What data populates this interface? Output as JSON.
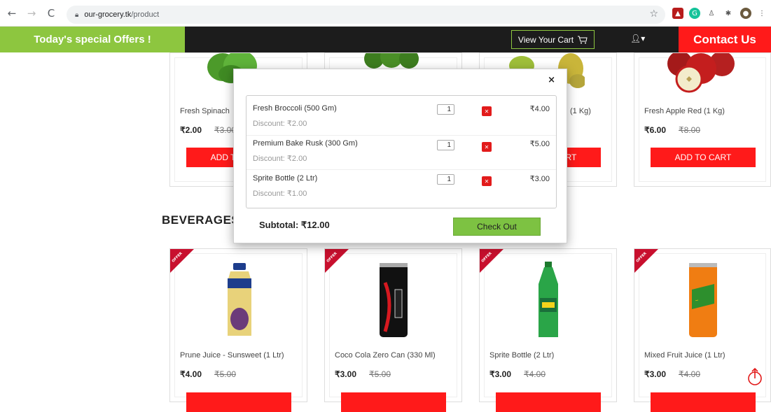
{
  "browser": {
    "url_host": "our-grocery.tk",
    "url_path": "/product"
  },
  "navbar": {
    "offers": "Today's special Offers !",
    "view_cart": "View Your Cart",
    "contact": "Contact Us"
  },
  "top_products": [
    {
      "name": "Fresh Spinach",
      "price": "₹2.00",
      "old_price": "₹3.00",
      "button": "ADD TO CART"
    },
    {
      "name": "",
      "price": "",
      "old_price": "",
      "button": ""
    },
    {
      "name": "(1 Kg)",
      "price": "",
      "old_price": "",
      "button": "ADD TO CART"
    },
    {
      "name": "Fresh Apple Red (1 Kg)",
      "price": "₹6.00",
      "old_price": "₹8.00",
      "button": "ADD TO CART"
    }
  ],
  "section_title": "BEVERAGES",
  "beverages": [
    {
      "name": "Prune Juice - Sunsweet (1 Ltr)",
      "price": "₹4.00",
      "old_price": "₹5.00",
      "ribbon": "OFFER"
    },
    {
      "name": "Coco Cola Zero Can (330 Ml)",
      "price": "₹3.00",
      "old_price": "₹5.00",
      "ribbon": "OFFER"
    },
    {
      "name": "Sprite Bottle (2 Ltr)",
      "price": "₹3.00",
      "old_price": "₹4.00",
      "ribbon": "OFFER"
    },
    {
      "name": "Mixed Fruit Juice (1 Ltr)",
      "price": "₹3.00",
      "old_price": "₹4.00",
      "ribbon": "OFFER"
    }
  ],
  "cart": {
    "close": "×",
    "items": [
      {
        "name": "Fresh Broccoli (500 Gm)",
        "discount": "Discount: ₹2.00",
        "qty": "1",
        "price": "₹4.00"
      },
      {
        "name": "Premium Bake Rusk (300 Gm)",
        "discount": "Discount: ₹2.00",
        "qty": "1",
        "price": "₹5.00"
      },
      {
        "name": "Sprite Bottle (2 Ltr)",
        "discount": "Discount: ₹1.00",
        "qty": "1",
        "price": "₹3.00"
      }
    ],
    "subtotal": "Subtotal: ₹12.00",
    "checkout": "Check Out"
  },
  "colors": {
    "green": "#8dc63f",
    "red": "#ff1a1a",
    "dark": "#1c1c1c"
  }
}
